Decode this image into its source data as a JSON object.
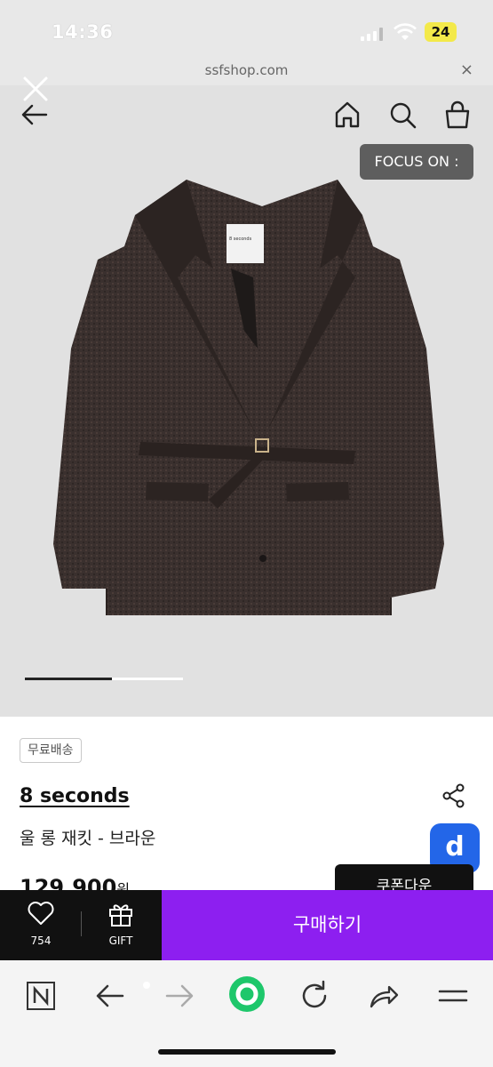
{
  "status_bar": {
    "time": "14:36",
    "battery": "24"
  },
  "url_bar": {
    "url": "ssfshop.com",
    "close": "×"
  },
  "hero": {
    "focus_label": "FOCUS ON :",
    "image_progress": 0.55
  },
  "product": {
    "shipping_badge": "무료배송",
    "brand": "8 seconds",
    "name": "울 롱 재킷 - 브라운",
    "price": "129,900",
    "currency": "원",
    "coupon_label": "쿠폰다운",
    "badge_letter": "d",
    "tag_text": "8 seconds"
  },
  "action_bar": {
    "like_count": "754",
    "gift_label": "GIFT",
    "buy_label": "구매하기",
    "accent_color": "#8d1ff0"
  },
  "browser_toolbar": {
    "icons": [
      "naver-icon",
      "back-icon",
      "forward-icon",
      "green-dot-icon",
      "refresh-icon",
      "share-icon",
      "menu-icon"
    ]
  }
}
